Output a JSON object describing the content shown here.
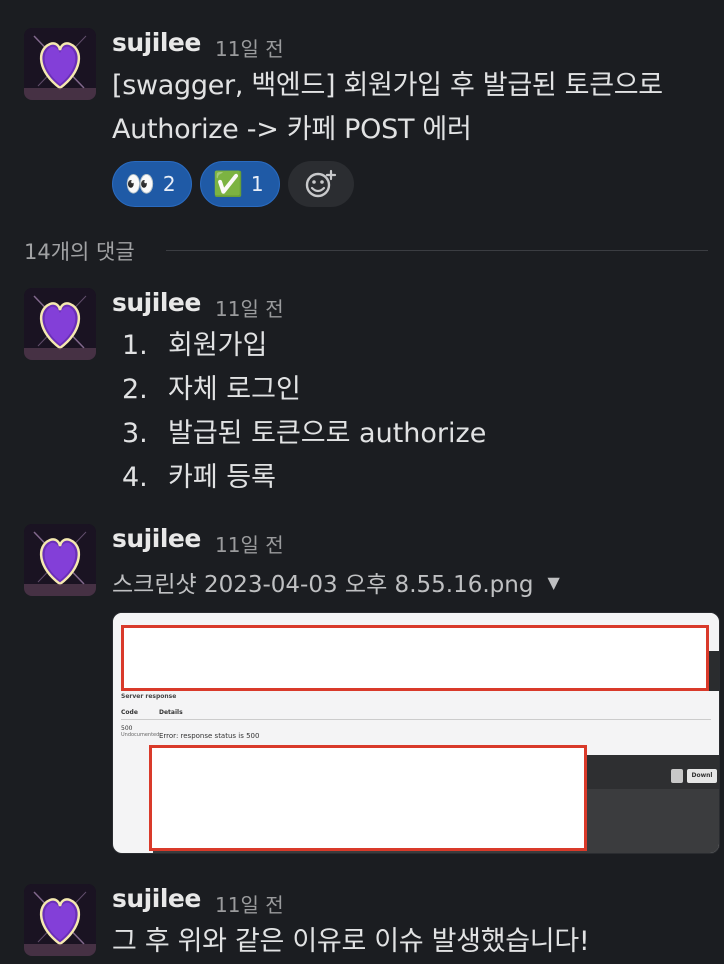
{
  "parent_message": {
    "username": "sujilee",
    "time": "11일 전",
    "line1": "[swagger, 백엔드] 회원가입 후 발급된 토큰으로",
    "line2": "Authorize -> 카페 POST 에러",
    "reactions": [
      {
        "emoji": "👀",
        "count": "2",
        "icon": "eyes-emoji"
      },
      {
        "emoji": "✅",
        "count": "1",
        "icon": "check-mark-emoji"
      }
    ],
    "add_reaction_icon": "add-reaction-icon"
  },
  "thread": {
    "reply_count_label": "14개의 댓글"
  },
  "replies": {
    "r1": {
      "username": "sujilee",
      "time": "11일 전",
      "steps": [
        {
          "num": "1.",
          "text": "회원가입"
        },
        {
          "num": "2.",
          "text": "자체 로그인"
        },
        {
          "num": "3.",
          "text": "발급된 토큰으로 authorize"
        },
        {
          "num": "4.",
          "text": "카페 등록"
        }
      ]
    },
    "r2": {
      "username": "sujilee",
      "time": "11일 전",
      "file_name": "스크린샷 2023-04-03 오후 8.55.16.png",
      "preview": {
        "section_title": "Server response",
        "col_code": "Code",
        "col_details": "Details",
        "code": "500",
        "code_note": "Undocumented",
        "error_text": "Error: response status is 500",
        "download_label": "Downl"
      }
    },
    "r3": {
      "username": "sujilee",
      "time": "11일 전",
      "text": "그 후 위와 같은 이유로 이슈 발생했습니다!"
    }
  },
  "colors": {
    "background": "#1b1d21",
    "reaction_active": "#1f5aa6",
    "redaction_border": "#d93a2a"
  }
}
